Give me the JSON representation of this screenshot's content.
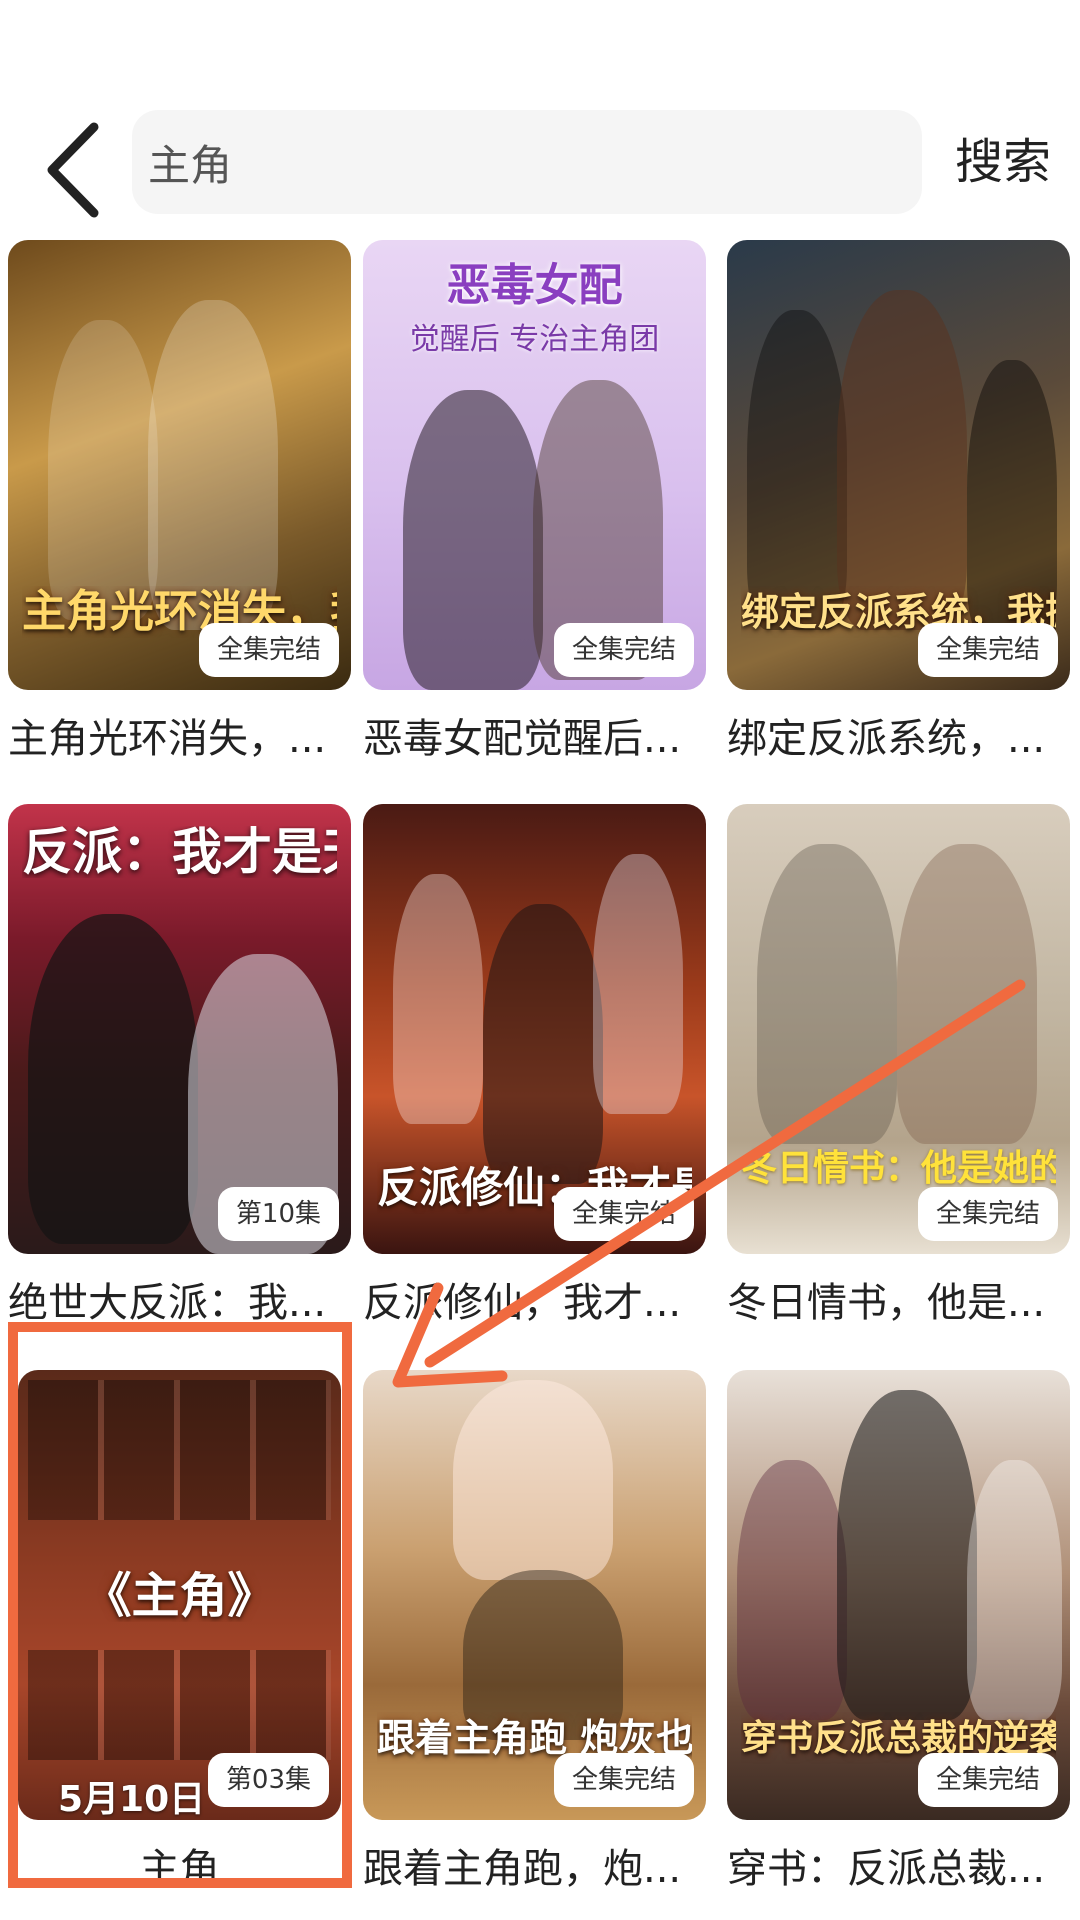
{
  "header": {
    "search_value": "主角",
    "search_action": "搜索"
  },
  "cards": [
    {
      "title": "主角光环消失，...",
      "badge": "全集完结",
      "poster_text": "主角光环消失，我只想..."
    },
    {
      "title": "恶毒女配觉醒后...",
      "badge": "全集完结",
      "poster_text": "恶毒女配",
      "poster_sub": "觉醒后 专治主角团"
    },
    {
      "title": "绑定反派系统，...",
      "badge": "全集完结",
      "poster_text": "绑定反派系统，我掀翻主角团"
    },
    {
      "title": "绝世大反派：我...",
      "badge": "第10集",
      "poster_text": "反派：我才是天"
    },
    {
      "title": "反派修仙，我才...",
      "badge": "全集完结",
      "poster_text": "反派修仙：我才是主角"
    },
    {
      "title": "冬日情书，他是...",
      "badge": "全集完结",
      "poster_text": "冬日情书：他是她的男主角"
    },
    {
      "title": "主角",
      "badge": "第03集",
      "poster_text": "《主角》",
      "poster_sub": "5月10日"
    },
    {
      "title": "跟着主角跑，炮...",
      "badge": "全集完结",
      "poster_text": "跟着主角跑 炮灰也成宝"
    },
    {
      "title": "穿书：反派总裁...",
      "badge": "全集完结",
      "poster_text": "穿书反派总裁的逆袭之路"
    }
  ],
  "colors": {
    "highlight": "#f06a3f",
    "search_bg": "#f5f5f5"
  }
}
